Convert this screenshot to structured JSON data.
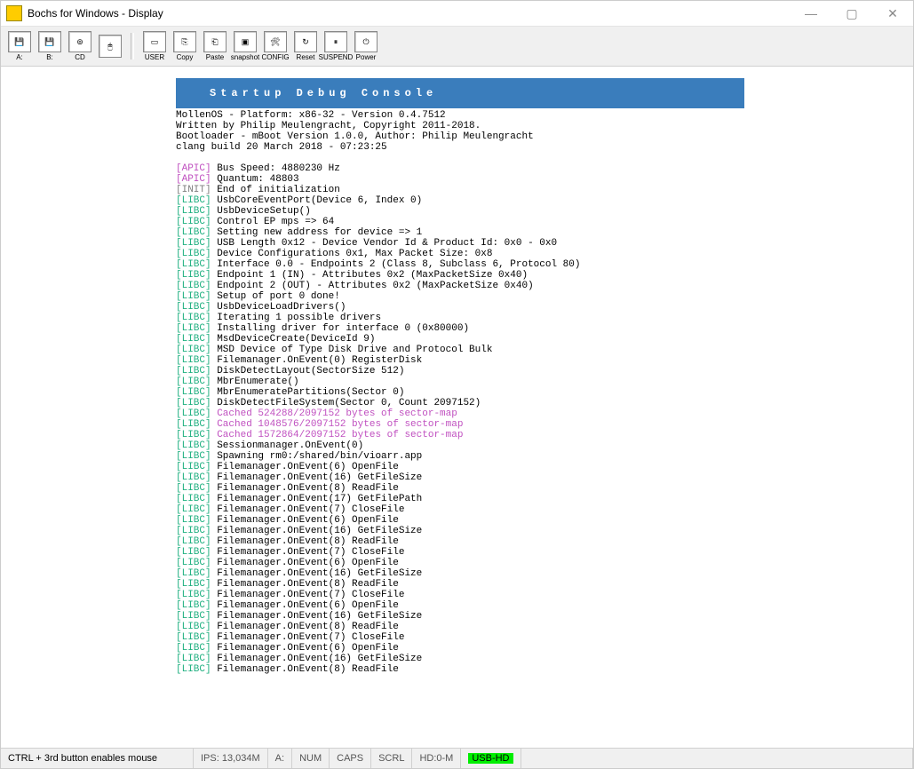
{
  "window": {
    "title": "Bochs for Windows - Display"
  },
  "toolbar": {
    "items": [
      {
        "name": "floppy-a",
        "label": "A:",
        "icon": "💾"
      },
      {
        "name": "floppy-b",
        "label": "B:",
        "icon": "💾"
      },
      {
        "name": "cdrom",
        "label": "CD",
        "icon": "⊚"
      },
      {
        "name": "mouse",
        "label": "",
        "icon": "🖱"
      },
      {
        "name": "sep1",
        "sep": true
      },
      {
        "name": "user",
        "label": "USER",
        "icon": "▭"
      },
      {
        "name": "copy",
        "label": "Copy",
        "icon": "⎘"
      },
      {
        "name": "paste",
        "label": "Paste",
        "icon": "⎗"
      },
      {
        "name": "snapshot",
        "label": "snapshot",
        "icon": "▣"
      },
      {
        "name": "config",
        "label": "CONFIG",
        "icon": "🛠"
      },
      {
        "name": "reset",
        "label": "Reset",
        "icon": "↻"
      },
      {
        "name": "suspend",
        "label": "SUSPEND",
        "icon": "⏸"
      },
      {
        "name": "power",
        "label": "Power",
        "icon": "⏻"
      }
    ]
  },
  "console": {
    "header": "Startup Debug Console",
    "intro_lines": [
      "MollenOS - Platform: x86-32 - Version 0.4.7512",
      "Written by Philip Meulengracht, Copyright 2011-2018.",
      "Bootloader - mBoot Version 1.0.0, Author: Philip Meulengracht",
      "clang build 20 March 2018 - 07:23:25"
    ],
    "log_lines": [
      {
        "tag": "APIC",
        "tag_class": "tag-apic",
        "msg": "Bus Speed: 4880230 Hz"
      },
      {
        "tag": "APIC",
        "tag_class": "tag-apic",
        "msg": "Quantum: 48803"
      },
      {
        "tag": "INIT",
        "tag_class": "tag-init",
        "msg": "End of initialization"
      },
      {
        "tag": "LIBC",
        "tag_class": "tag-libc",
        "msg": "UsbCoreEventPort(Device 6, Index 0)"
      },
      {
        "tag": "LIBC",
        "tag_class": "tag-libc",
        "msg": "UsbDeviceSetup()"
      },
      {
        "tag": "LIBC",
        "tag_class": "tag-libc",
        "msg": "Control EP mps => 64"
      },
      {
        "tag": "LIBC",
        "tag_class": "tag-libc",
        "msg": "Setting new address for device => 1"
      },
      {
        "tag": "LIBC",
        "tag_class": "tag-libc",
        "msg": "USB Length 0x12 - Device Vendor Id & Product Id: 0x0 - 0x0"
      },
      {
        "tag": "LIBC",
        "tag_class": "tag-libc",
        "msg": "Device Configurations 0x1, Max Packet Size: 0x8"
      },
      {
        "tag": "LIBC",
        "tag_class": "tag-libc",
        "msg": "Interface 0.0 - Endpoints 2 (Class 8, Subclass 6, Protocol 80)"
      },
      {
        "tag": "LIBC",
        "tag_class": "tag-libc",
        "msg": "Endpoint 1 (IN) - Attributes 0x2 (MaxPacketSize 0x40)"
      },
      {
        "tag": "LIBC",
        "tag_class": "tag-libc",
        "msg": "Endpoint 2 (OUT) - Attributes 0x2 (MaxPacketSize 0x40)"
      },
      {
        "tag": "LIBC",
        "tag_class": "tag-libc",
        "msg": "Setup of port 0 done!"
      },
      {
        "tag": "LIBC",
        "tag_class": "tag-libc",
        "msg": "UsbDeviceLoadDrivers()"
      },
      {
        "tag": "LIBC",
        "tag_class": "tag-libc",
        "msg": "Iterating 1 possible drivers"
      },
      {
        "tag": "LIBC",
        "tag_class": "tag-libc",
        "msg": "Installing driver for interface 0 (0x80000)"
      },
      {
        "tag": "LIBC",
        "tag_class": "tag-libc",
        "msg": "MsdDeviceCreate(DeviceId 9)"
      },
      {
        "tag": "LIBC",
        "tag_class": "tag-libc",
        "msg": "MSD Device of Type Disk Drive and Protocol Bulk"
      },
      {
        "tag": "LIBC",
        "tag_class": "tag-libc",
        "msg": "Filemanager.OnEvent(0) RegisterDisk"
      },
      {
        "tag": "LIBC",
        "tag_class": "tag-libc",
        "msg": "DiskDetectLayout(SectorSize 512)"
      },
      {
        "tag": "LIBC",
        "tag_class": "tag-libc",
        "msg": "MbrEnumerate()"
      },
      {
        "tag": "LIBC",
        "tag_class": "tag-libc",
        "msg": "MbrEnumeratePartitions(Sector 0)"
      },
      {
        "tag": "LIBC",
        "tag_class": "tag-libc",
        "msg": "DiskDetectFileSystem(Sector 0, Count 2097152)"
      },
      {
        "tag": "LIBC",
        "tag_class": "tag-libc",
        "msg": "Cached 524288/2097152 bytes of sector-map",
        "msg_class": "txt-purple"
      },
      {
        "tag": "LIBC",
        "tag_class": "tag-libc",
        "msg": "Cached 1048576/2097152 bytes of sector-map",
        "msg_class": "txt-purple"
      },
      {
        "tag": "LIBC",
        "tag_class": "tag-libc",
        "msg": "Cached 1572864/2097152 bytes of sector-map",
        "msg_class": "txt-purple"
      },
      {
        "tag": "LIBC",
        "tag_class": "tag-libc",
        "msg": "Sessionmanager.OnEvent(0)"
      },
      {
        "tag": "LIBC",
        "tag_class": "tag-libc",
        "msg": "Spawning rm0:/shared/bin/vioarr.app"
      },
      {
        "tag": "LIBC",
        "tag_class": "tag-libc",
        "msg": "Filemanager.OnEvent(6) OpenFile"
      },
      {
        "tag": "LIBC",
        "tag_class": "tag-libc",
        "msg": "Filemanager.OnEvent(16) GetFileSize"
      },
      {
        "tag": "LIBC",
        "tag_class": "tag-libc",
        "msg": "Filemanager.OnEvent(8) ReadFile"
      },
      {
        "tag": "LIBC",
        "tag_class": "tag-libc",
        "msg": "Filemanager.OnEvent(17) GetFilePath"
      },
      {
        "tag": "LIBC",
        "tag_class": "tag-libc",
        "msg": "Filemanager.OnEvent(7) CloseFile"
      },
      {
        "tag": "LIBC",
        "tag_class": "tag-libc",
        "msg": "Filemanager.OnEvent(6) OpenFile"
      },
      {
        "tag": "LIBC",
        "tag_class": "tag-libc",
        "msg": "Filemanager.OnEvent(16) GetFileSize"
      },
      {
        "tag": "LIBC",
        "tag_class": "tag-libc",
        "msg": "Filemanager.OnEvent(8) ReadFile"
      },
      {
        "tag": "LIBC",
        "tag_class": "tag-libc",
        "msg": "Filemanager.OnEvent(7) CloseFile"
      },
      {
        "tag": "LIBC",
        "tag_class": "tag-libc",
        "msg": "Filemanager.OnEvent(6) OpenFile"
      },
      {
        "tag": "LIBC",
        "tag_class": "tag-libc",
        "msg": "Filemanager.OnEvent(16) GetFileSize"
      },
      {
        "tag": "LIBC",
        "tag_class": "tag-libc",
        "msg": "Filemanager.OnEvent(8) ReadFile"
      },
      {
        "tag": "LIBC",
        "tag_class": "tag-libc",
        "msg": "Filemanager.OnEvent(7) CloseFile"
      },
      {
        "tag": "LIBC",
        "tag_class": "tag-libc",
        "msg": "Filemanager.OnEvent(6) OpenFile"
      },
      {
        "tag": "LIBC",
        "tag_class": "tag-libc",
        "msg": "Filemanager.OnEvent(16) GetFileSize"
      },
      {
        "tag": "LIBC",
        "tag_class": "tag-libc",
        "msg": "Filemanager.OnEvent(8) ReadFile"
      },
      {
        "tag": "LIBC",
        "tag_class": "tag-libc",
        "msg": "Filemanager.OnEvent(7) CloseFile"
      },
      {
        "tag": "LIBC",
        "tag_class": "tag-libc",
        "msg": "Filemanager.OnEvent(6) OpenFile"
      },
      {
        "tag": "LIBC",
        "tag_class": "tag-libc",
        "msg": "Filemanager.OnEvent(16) GetFileSize"
      },
      {
        "tag": "LIBC",
        "tag_class": "tag-libc",
        "msg": "Filemanager.OnEvent(8) ReadFile"
      }
    ]
  },
  "statusbar": {
    "hint": "CTRL + 3rd button enables mouse",
    "ips": "IPS: 13,034M",
    "drive": "A:",
    "num": "NUM",
    "caps": "CAPS",
    "scrl": "SCRL",
    "hd": "HD:0-M",
    "usb": "USB-HD"
  }
}
